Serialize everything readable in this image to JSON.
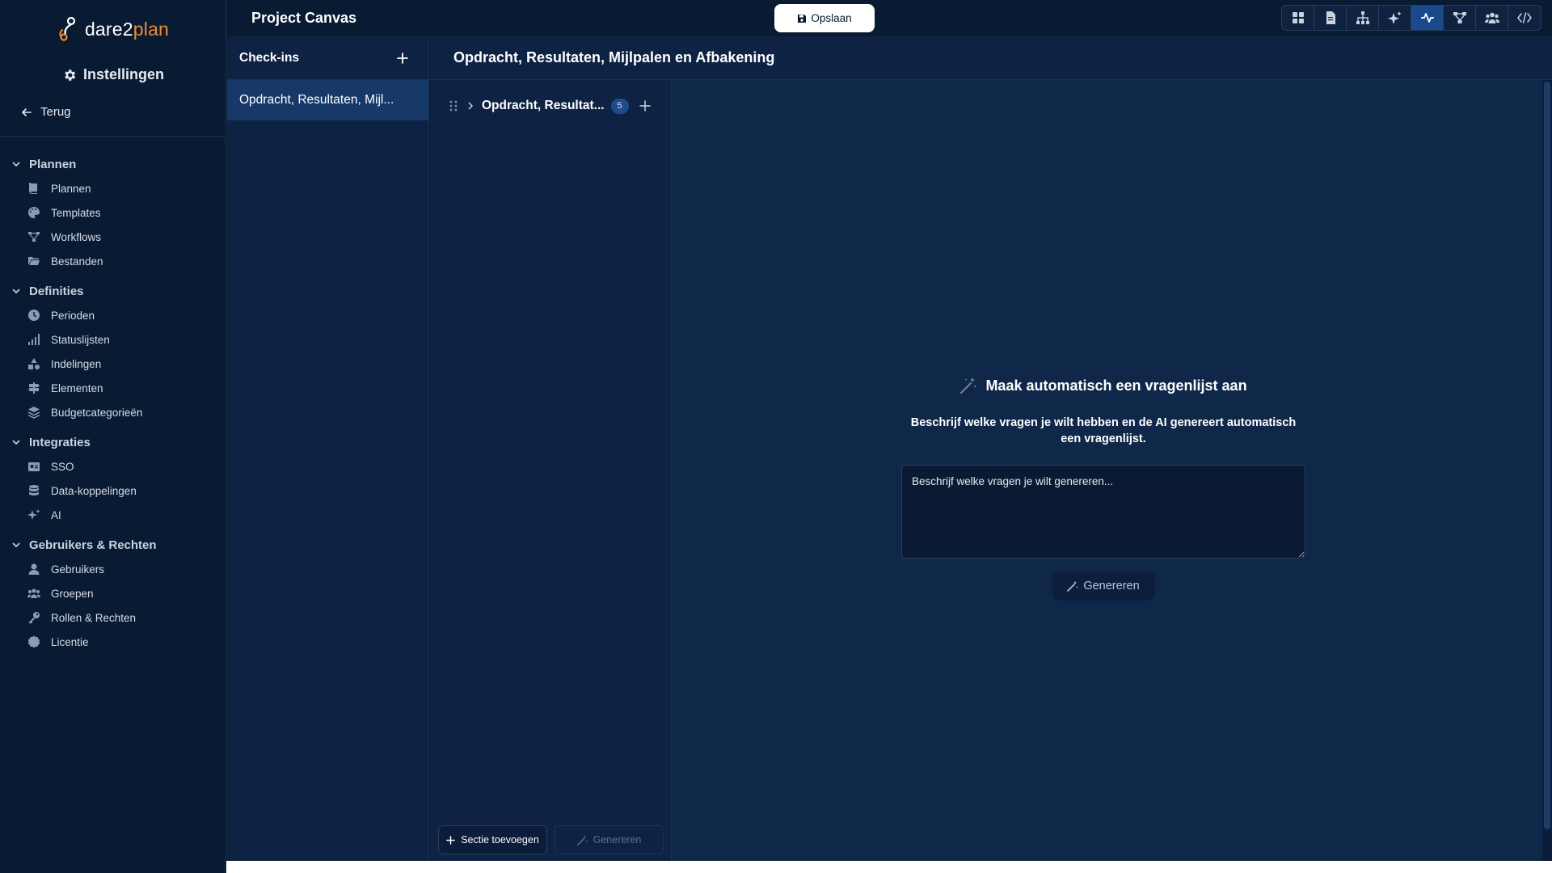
{
  "brand": {
    "logo_part1": "dare2",
    "logo_part2": "plan",
    "accent": "#f08c2e"
  },
  "sidebar": {
    "title": "Instellingen",
    "back_label": "Terug",
    "groups": [
      {
        "label": "Plannen",
        "items": [
          {
            "label": "Plannen",
            "icon": "book-icon"
          },
          {
            "label": "Templates",
            "icon": "palette-icon"
          },
          {
            "label": "Workflows",
            "icon": "workflow-icon"
          },
          {
            "label": "Bestanden",
            "icon": "folder-icon"
          }
        ]
      },
      {
        "label": "Definities",
        "items": [
          {
            "label": "Perioden",
            "icon": "clock-icon"
          },
          {
            "label": "Statuslijsten",
            "icon": "signal-icon"
          },
          {
            "label": "Indelingen",
            "icon": "shapes-icon"
          },
          {
            "label": "Elementen",
            "icon": "signpost-icon"
          },
          {
            "label": "Budgetcategorieën",
            "icon": "layers-icon"
          }
        ]
      },
      {
        "label": "Integraties",
        "items": [
          {
            "label": "SSO",
            "icon": "id-card-icon"
          },
          {
            "label": "Data-koppelingen",
            "icon": "database-icon"
          },
          {
            "label": "AI",
            "icon": "sparkles-icon"
          }
        ]
      },
      {
        "label": "Gebruikers & Rechten",
        "items": [
          {
            "label": "Gebruikers",
            "icon": "user-icon"
          },
          {
            "label": "Groepen",
            "icon": "users-icon"
          },
          {
            "label": "Rollen & Rechten",
            "icon": "key-icon"
          },
          {
            "label": "Licentie",
            "icon": "badge-icon"
          }
        ]
      }
    ]
  },
  "header": {
    "project_title": "Project Canvas",
    "save_label": "Opslaan",
    "toolbar_icons": [
      "grid-icon",
      "document-icon",
      "hierarchy-icon",
      "sparkles-icon",
      "pulse-icon",
      "workflow-icon",
      "users-icon",
      "code-icon"
    ],
    "active_tool_index": 4
  },
  "checkins": {
    "title": "Check-ins",
    "items": [
      "Opdracht, Resultaten, Mijl..."
    ]
  },
  "main": {
    "title": "Opdracht, Resultaten, Mijlpalen en Afbakening",
    "section": {
      "title": "Opdracht, Resultat...",
      "count": "5"
    },
    "add_section_label": "Sectie toevoegen",
    "generate_label": "Genereren"
  },
  "ai": {
    "title": "Maak automatisch een vragenlijst aan",
    "description": "Beschrijf welke vragen je wilt hebben en de AI genereert automatisch een vragenlijst.",
    "placeholder": "Beschrijf welke vragen je wilt genereren...",
    "button_label": "Genereren"
  }
}
